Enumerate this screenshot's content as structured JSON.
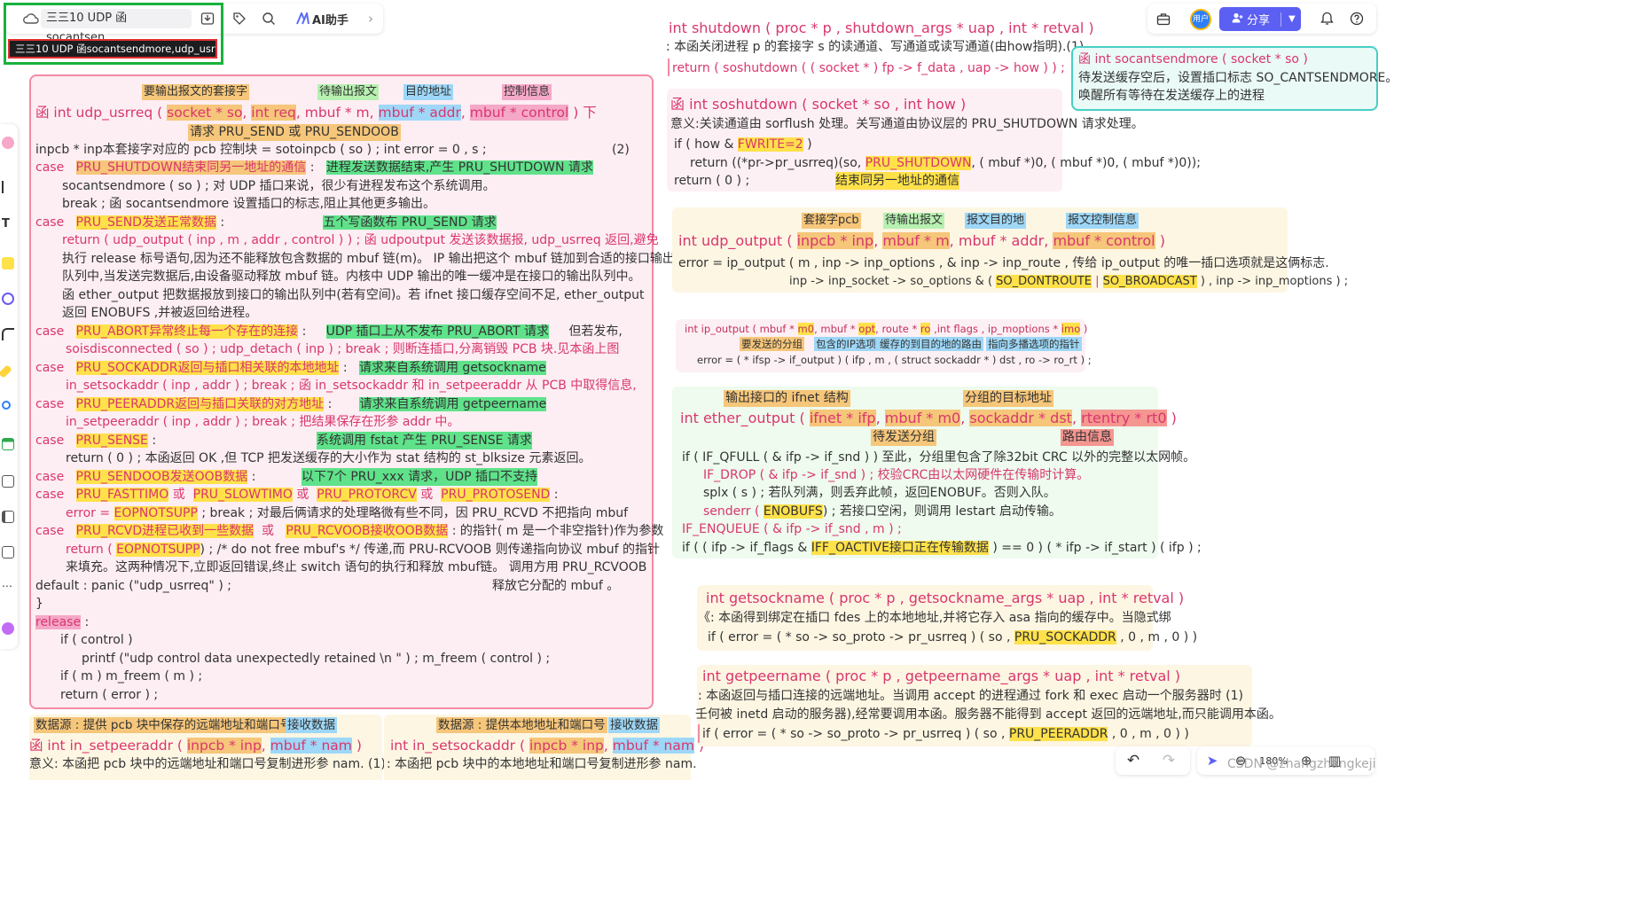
{
  "toolbar": {
    "doc_title": "三三10 UDP 函socantsen...",
    "tooltip": "三三10 UDP 函socantsendmore,udp_usrreq下",
    "ai_label": "AI助手",
    "share_label": "分享",
    "avatar_label": "用户",
    "zoom_label": "180%",
    "watermark": "CSDN @zhangzhangkeji"
  },
  "usrreq": {
    "ann1": "要输出报文的套接字",
    "ann2": "待输出报文",
    "ann3": "目的地址",
    "ann4": "控制信息",
    "sig_prefix": "函  int  udp_usrreq (",
    "p1": "socket * so",
    "p2": "int  req",
    "p3": "mbuf  * m",
    "p4": "mbuf  * addr",
    "p5": "mbuf  * control",
    "sig_suffix": ")   下",
    "note_req": "请求 PRU_SEND 或 PRU_SENDOOB",
    "l_inpcb": "inpcb  *  inp本套接字对应的 pcb 控制块  =  sotoinpcb ( so ) ;           int  error  =  0 ,  s ;",
    "l_inpcb_n": "(2)",
    "c1_kw": "case",
    "c1_lbl": "PRU_SHUTDOWN结束同另一地址的通信",
    "c1_note": "进程发送数据结束,产生 PRU_SHUTDOWN 请求",
    "c1_l1": "socantsendmore ( so ) ;                对 UDP 插口来说，很少有进程发布这个系统调用。",
    "c1_l2": "break ;                                    函 socantsendmore 设置插口的标志,阻止其他更多输出。",
    "c2_kw": "case",
    "c2_lbl": "PRU_SEND发送正常数据",
    "c2_note": "五个写函数布 PRU_SEND 请求",
    "c2_l1": "return  ( udp_output ( inp , m , addr , control ) ) ;   函 udpoutput 发送该数据报, udp_usrreq 返回,避免",
    "c2_l2": "执行 release 标号语句,因为还不能释放包含数据的 mbuf 链(m)。 IP 输出把这个 mbuf 链加到合适的接口输出",
    "c2_l3": "队列中,当发送完数据后,由设备驱动释放 mbuf 链。内核中 UDP 输出的唯一缓冲是在接口的输出队列中。",
    "c2_l4": "函  ether_output 把数据报放到接口的输出队列中(若有空间)。若 ifnet 接口缓存空间不足, ether_output",
    "c2_l5": "返回 ENOBUFS ,并被返回给进程。",
    "c3_kw": "case",
    "c3_lbl": "PRU_ABORT异常终止每一个存在的连接",
    "c3_note": "UDP 插口上从不发布 PRU_ABORT 请求",
    "c3_extra": "但若发布,",
    "c3_l1": "soisdisconnected ( so ) ;        udp_detach ( inp ) ;        break ;     则断连插口,分离销毁 PCB 块.见本函上图",
    "c4_kw": "case",
    "c4_lbl": "PRU_SOCKADDR返回与插口相关联的本地地址",
    "c4_note": "请求来自系统调用 getsockname",
    "c4_l1": "in_setsockaddr ( inp , addr ) ;        break ;      函 in_setsockaddr 和 in_setpeeraddr 从 PCB 中取得信息,",
    "c5_kw": "case",
    "c5_lbl": "PRU_PEERADDR返回与插口关联的对方地址",
    "c5_note": "请求来自系统调用 getpeername",
    "c5_l1": "in_setpeeraddr ( inp , addr ) ;       break ;       把结果保存在形参 addr 中。",
    "c6_kw": "case",
    "c6_lbl": "PRU_SENSE",
    "c6_note": "系统调用 fstat 产生 PRU_SENSE 请求",
    "c6_l1": "return ( 0 ) ;                     本函返回 OK ,但 TCP 把发送缓存的大小作为 stat 结构的 st_blksize 元素返回。",
    "c7_kw": "case",
    "c7_lbl": "PRU_SENDOOB发送OOB数据",
    "c7_colon": " :",
    "c7_note": "以下7个 PRU_xxx 请求，UDP 插口不支持",
    "c8_kw": "case",
    "c8_a": "PRU_FASTTIMO",
    "c8_or1": "或",
    "c8_b": "PRU_SLOWTIMO",
    "c8_or2": "或",
    "c8_c": "PRU_PROTORCV",
    "c8_or3": "或",
    "c8_d": "PRU_PROTOSEND",
    "c8_l1_a": "error  =",
    "c8_l1_b": "EOPNOTSUPP",
    "c8_l1_c": " ;      break ;         对最后俩请求的处理略微有些不同，因 PRU_RCVD 不把指向 mbuf",
    "c9_kw": "case",
    "c9_a": "PRU_RCVD进程已收到一些数据",
    "c9_or": "或",
    "c9_b": "PRU_RCVOOB接收OOB数据",
    "c9_note": " :  的指针( m 是一个非空指针)作为参数",
    "c9_l1_a": "return  (",
    "c9_l1_b": "EOPNOTSUPP",
    "c9_l1_c": ") ;  /* do not free mbuf's */      传递,而 PRU-RCVOOB 则传递指向协议 mbuf 的指针",
    "c9_l2": "来填充。这两种情况下,立即返回错误,终止 switch 语句的执行和释放 mbuf链。 调用方用 PRU_RCVOOB",
    "default_line": "default :        panic (\"udp_usrreq\" ) ;",
    "default_note": "释放它分配的 mbuf 。",
    "close_brace": "}",
    "release_kw": "release",
    "release_colon": " :",
    "r_l1": "if ( control )",
    "r_l2": "printf (\"udp  control  data  unexpectedly  retained \\n \" ) ;        m_freem ( control ) ;",
    "r_l3": "if ( m )      m_freem ( m ) ;",
    "r_l4": "return  ( error ) ;"
  },
  "setpeer": {
    "ann1": "数据源 : 提供 pcb 块中保存的远端地址和端口号",
    "ann2": "接收数据",
    "sig_prefix": "函   int  in_setpeeraddr (",
    "p1": "inpcb * inp",
    "p2": "mbuf  * nam",
    "sig_suffix": ")",
    "desc": "意义: 本函把 pcb 块中的远端地址和端口号复制进形参 nam.  (1)"
  },
  "setsock": {
    "ann1": "数据源 : 提供本地地址和端口号",
    "ann2": "接收数据",
    "sig_prefix": "int  in_setsockaddr (",
    "p1": "inpcb * inp",
    "p2": "mbuf  * nam",
    "sig_suffix": ")",
    "desc": ": 本函把 pcb 块中的本地地址和端口号复制进形参 nam."
  },
  "shutdown": {
    "sig": "int  shutdown ( proc  * p , shutdown_args  * uap , int * retval )",
    "desc": ": 本函关闭进程 p 的套接字 s 的读通道、写通道或读写通道(由how指明).(1)",
    "ret": "return   ( soshutdown ( ( socket * ) fp -> f_data , uap -> how ) ) ;"
  },
  "socant": {
    "sig": "函   int   socantsendmore ( socket * so )",
    "desc1": "待发送缓存空后，设置插口标志 SO_CANTSENDMORE。",
    "desc2": "唤醒所有等待在发送缓存上的进程"
  },
  "soshut": {
    "sig": "函    int  soshutdown ( socket * so , int  how )",
    "desc": "意义:关读通道由 sorflush 处理。关写通道由协议层的 PRU_SHUTDOWN 请求处理。",
    "l1_a": "if ( how  &",
    "l1_b": "FWRITE=2",
    "l1_c": ")",
    "l2_a": "return ((*pr->pr_usrreq)(so,",
    "l2_b": "PRU_SHUTDOWN",
    "l2_c": ", ( mbuf *)0, ( mbuf *)0, ( mbuf *)0));",
    "l3": "return ( 0 ) ;",
    "note": "结束同另一地址的通信"
  },
  "udpout": {
    "ann1": "套接字pcb",
    "ann2": "待输出报文",
    "ann3": "报文目的地",
    "ann4": "报文控制信息",
    "sig_prefix": "int  udp_output (",
    "p1": "inpcb  *  inp",
    "p2": "mbuf  * m",
    "p3": "mbuf  *  addr",
    "p4": "mbuf  *  control",
    "sig_suffix": ")",
    "l1": "error  =  ip_output ( m , inp -> inp_options , & inp -> inp_route ,   传给 ip_output 的唯一插口选项就是这俩标志.",
    "l2_a": "inp -> inp_socket -> so_options  &  (",
    "l2_b": "SO_DONTROUTE",
    "l2_sep": "|",
    "l2_c": "SO_BROADCAST",
    "l2_d": ") ,  inp -> inp_moptions ) ;"
  },
  "ipout": {
    "sig_a": "int  ip_output ( mbuf  *",
    "m0": "m0",
    "sig_b": ", mbuf  *",
    "opt": "opt",
    "sig_c": ", route  *",
    "ro": "ro",
    "sig_d": " ,int  flags ,  ip_moptions *",
    "imo": "imo",
    "sig_e": ")",
    "ann1": "要发送的分组",
    "ann2": "包含的IP选项",
    "ann3": "缓存的到目的地的路由",
    "ann4": "指向多播选项的指针",
    "l1": "error  =  ( * ifsp -> if_output ) ( ifp ,  m ,  ( struct  sockaddr  * ) dst ,  ro -> ro_rt ) ;"
  },
  "etherout": {
    "ann1": "输出接口的 ifnet 结构",
    "ann2": "分组的目标地址",
    "ann3": "待发送分组",
    "ann4": "路由信息",
    "sig_prefix": "int  ether_output (",
    "p1": "ifnet * ifp",
    "p2": "mbuf * m0",
    "p3": "sockaddr  *  dst",
    "p4": "rtentry  *  rt0",
    "sig_suffix": ")",
    "l1": "if  ( IF_QFULL ( & ifp -> if_snd ) )   至此，分组里包含了除32bit CRC 以外的完整以太网帧。",
    "l2": "IF_DROP ( & ifp -> if_snd ) ;        校验CRC由以太网硬件在传输时计算。",
    "l3": "splx ( s ) ;                          若队列满，则丢弃此帧，返回ENOBUF。否则入队。",
    "l4_a": "senderr (",
    "l4_b": "ENOBUFS",
    "l4_c": ") ;            若接口空闲，则调用 lestart 启动传输。",
    "l5": "IF_ENQUEUE ( & ifp -> if_snd ,  m ) ;",
    "l6_a": "if  ( ( ifp -> if_flags  &",
    "l6_b": "IFF_OACTIVE接口正在传输数据",
    "l6_c": ") == 0 )   ( * ifp -> if_start ) ( ifp ) ;"
  },
  "getsock": {
    "sig": "int   getsockname ( proc * p , getsockname_args  * uap , int * retval )",
    "desc": "《: 本函得到绑定在插口 fdes 上的本地地址,并将它存入 asa 指向的缓存中。当隐式绑",
    "l1_a": "if ( error  =  ( * so -> so_proto -> pr_usrreq ) ( so ,",
    "l1_b": "PRU_SOCKADDR",
    "l1_c": ", 0 , m , 0 ) )"
  },
  "getpeer": {
    "sig": "int   getpeername ( proc * p , getpeername_args  * uap , int * retval )",
    "desc1": ": 本函返回与插口连接的远端地址。当调用 accept 的进程通过 fork 和 exec 启动一个服务器时  (1)",
    "desc2": "壬何被 inetd 启动的服务器),经常要调用本函。服务器不能得到 accept 返回的远端地址,而只能调用本函。",
    "l1_a": "if ( error  =  ( * so -> so_proto -> pr_usrreq ) ( so ,",
    "l1_b": "PRU_PEERADDR",
    "l1_c": ", 0 , m , 0 ) )"
  }
}
